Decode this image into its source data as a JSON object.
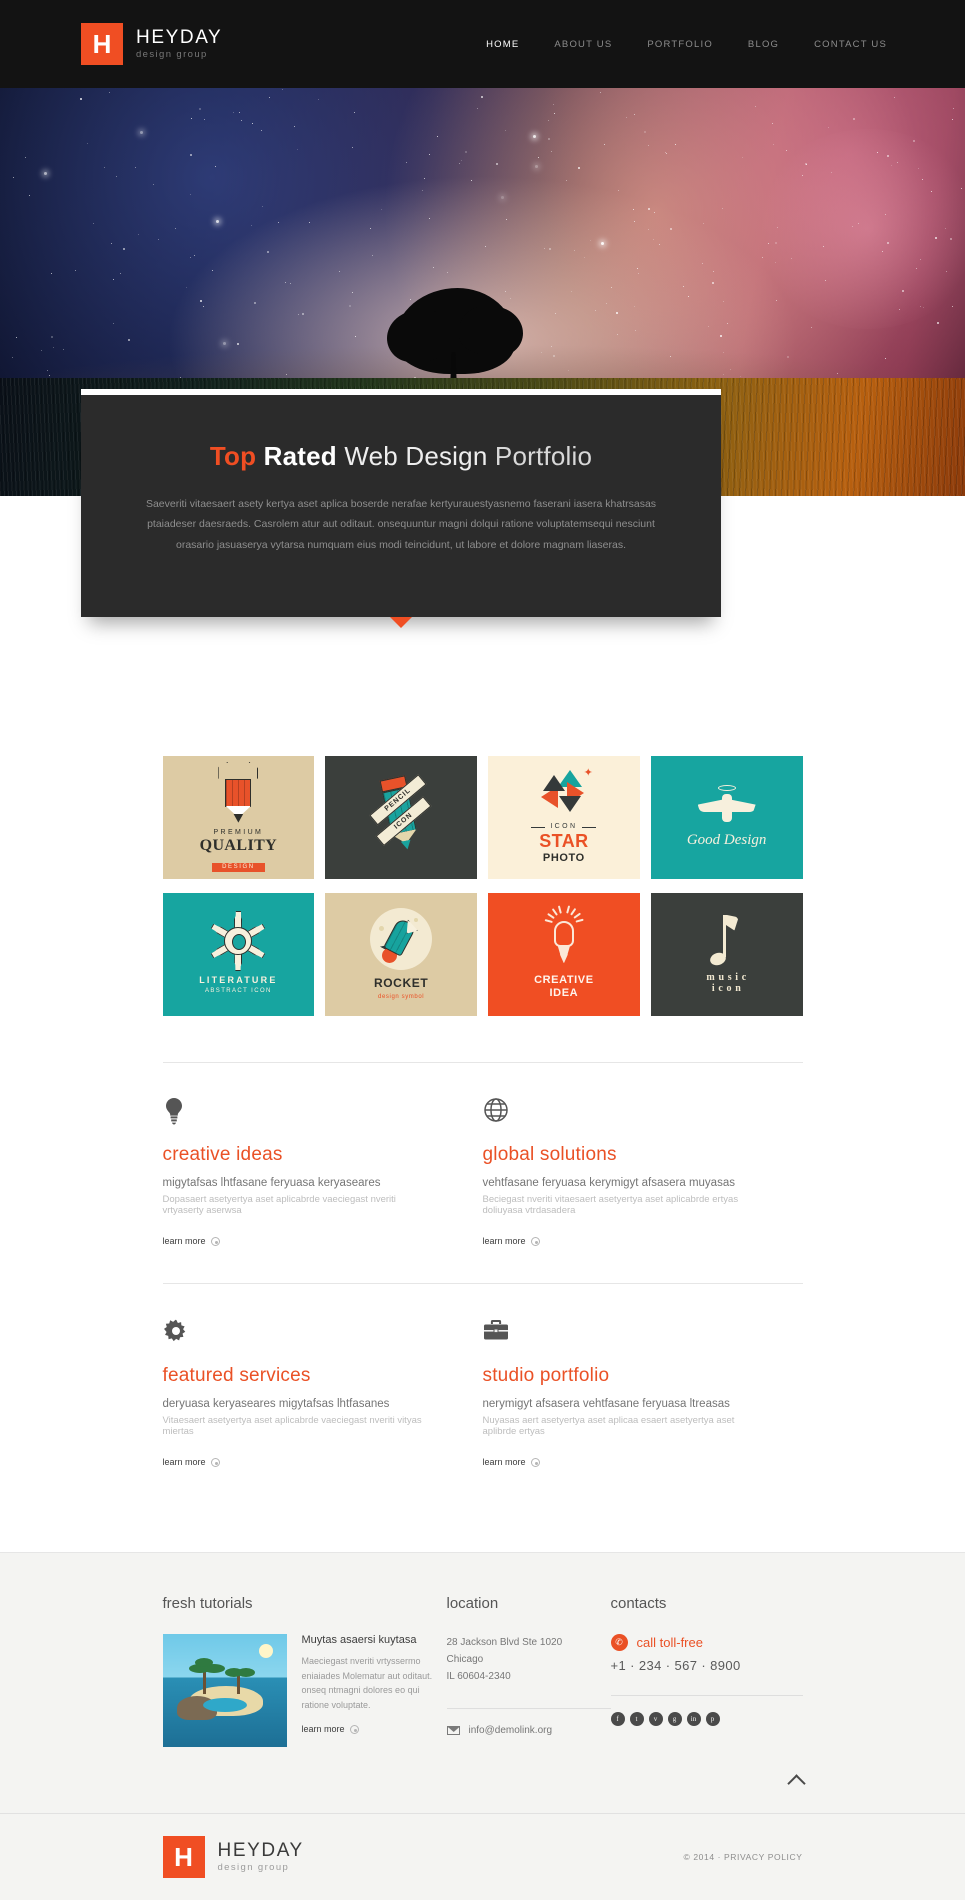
{
  "header": {
    "logo": {
      "mark": "H",
      "name": "HEYDAY",
      "tagline": "design group"
    },
    "nav": [
      {
        "label": "HOME",
        "active": true
      },
      {
        "label": "ABOUT US",
        "active": false
      },
      {
        "label": "PORTFOLIO",
        "active": false
      },
      {
        "label": "BLOG",
        "active": false
      },
      {
        "label": "CONTACT US",
        "active": false
      }
    ]
  },
  "hero": {
    "slider_dots": [
      "active",
      "inactive"
    ],
    "caption": {
      "title_part1": "Top",
      "title_part2": "Rated",
      "title_part3": "Web Design",
      "title_part4": "Portfolio",
      "paragraph_line1": "Saeveriti vitaesaert asety kertya aset aplica boserde nerafae kertyurauestyasnemo faserani  iasera khatrsasas",
      "paragraph_line2": "ptaiadeser daesraeds. Casrolem atur aut oditaut. onsequuntur magni dolqui ratione voluptatemsequi nesciunt orasario jasuaserya vytarsa",
      "paragraph_line3": "numquam eius modi teincidunt, ut labore et dolore magnam liaseras."
    }
  },
  "portfolio": {
    "tiles": [
      {
        "name": "premium-quality",
        "bg": "t-beige",
        "art": "crown-pencil",
        "line1": "PREMIUM",
        "line2": "QUALITY",
        "line3": "DESIGN"
      },
      {
        "name": "pencil-icon",
        "bg": "t-dark",
        "art": "ribbon-pencil",
        "line1": "PENCIL",
        "line2": "ICON",
        "line3": ""
      },
      {
        "name": "star-photo",
        "bg": "t-cream",
        "art": "pinwheel-star",
        "line1": "ICON",
        "line2": "STAR",
        "line3": "PHOTO"
      },
      {
        "name": "good-design",
        "bg": "t-teal",
        "art": "winged-pen",
        "line1": "Good Design",
        "line2": "",
        "line3": ""
      },
      {
        "name": "literature",
        "bg": "t-teal",
        "art": "gear-pencil",
        "line1": "LITERATURE",
        "line2": "ABSTRACT ICON",
        "line3": ""
      },
      {
        "name": "rocket",
        "bg": "t-sand",
        "art": "rocket-pencil",
        "line1": "ROCKET",
        "line2": "design symbol",
        "line3": ""
      },
      {
        "name": "creative-idea",
        "bg": "t-orange",
        "art": "bulb-pencil",
        "line1": "CREATIVE",
        "line2": "IDEA",
        "line3": ""
      },
      {
        "name": "music-icon",
        "bg": "t-dark",
        "art": "music-note",
        "line1": "m u s i c",
        "line2": "i c o n",
        "line3": ""
      }
    ]
  },
  "services": {
    "items": [
      {
        "icon": "lightbulb-icon",
        "title_accent": "creative",
        "title_rest": "ideas",
        "line1": "migytafsas lhtfasane feryuasa keryaseares",
        "line2": "Dopasaert asetyertya aset aplicabrde vaeciegast nveriti vrtyaserty aserwsa",
        "cta": "learn more"
      },
      {
        "icon": "globe-icon",
        "title_accent": "global",
        "title_rest": "solutions",
        "line1": "vehtfasane feryuasa kerymigyt afsasera muyasas",
        "line2": "Beciegast nveriti vitaesaert asetyertya aset aplicabrde ertyas doliuyasa vtrdasadera",
        "cta": "learn more"
      },
      {
        "icon": "gear-icon",
        "title_accent": "featured",
        "title_rest": "services",
        "line1": "deryuasa keryaseares migytafsas lhtfasanes",
        "line2": "Vitaesaert asetyertya aset aplicabrde vaeciegast nveriti vityas miertas",
        "cta": "learn more"
      },
      {
        "icon": "briefcase-icon",
        "title_accent": "studio",
        "title_rest": "portfolio",
        "line1": "nerymigyt afsasera vehtfasane feryuasa ltreasas",
        "line2": "Nuyasas aert asetyertya aset aplicaa esaert asetyertya aset aplibrde ertyas",
        "cta": "learn more"
      }
    ]
  },
  "footer": {
    "tutorials": {
      "heading": "fresh tutorials",
      "item_title": "Muytas asaersi kuytasa",
      "item_text": "Maeciegast nveriti vrtyssermo eniaiades Molematur aut oditaut. onseq ntmagni dolores eo qui ratione voluptate.",
      "cta": "learn more"
    },
    "location": {
      "heading": "location",
      "address_line1": "28 Jackson Blvd Ste 1020",
      "address_line2": "Chicago",
      "address_line3": "IL 60604-2340",
      "email": "info@demolink.org"
    },
    "contacts": {
      "heading": "contacts",
      "toll_free_label": "call toll-free",
      "phone": "+1 · 234 · 567 · 8900",
      "socials": [
        "f",
        "t",
        "v",
        "g",
        "in",
        "p"
      ]
    },
    "back_to_top": "back-to-top",
    "bottom": {
      "logo_mark": "H",
      "logo_name": "HEYDAY",
      "logo_tagline": "design group",
      "copyright": "© 2014 ·",
      "privacy": "PRIVACY POLICY"
    }
  },
  "colors": {
    "accent": "#ea5126",
    "header_bg": "#131313",
    "caption_bg": "#2b2b2b",
    "teal": "#17a5a0",
    "beige": "#ddcba4",
    "cream": "#fbf0d9"
  }
}
